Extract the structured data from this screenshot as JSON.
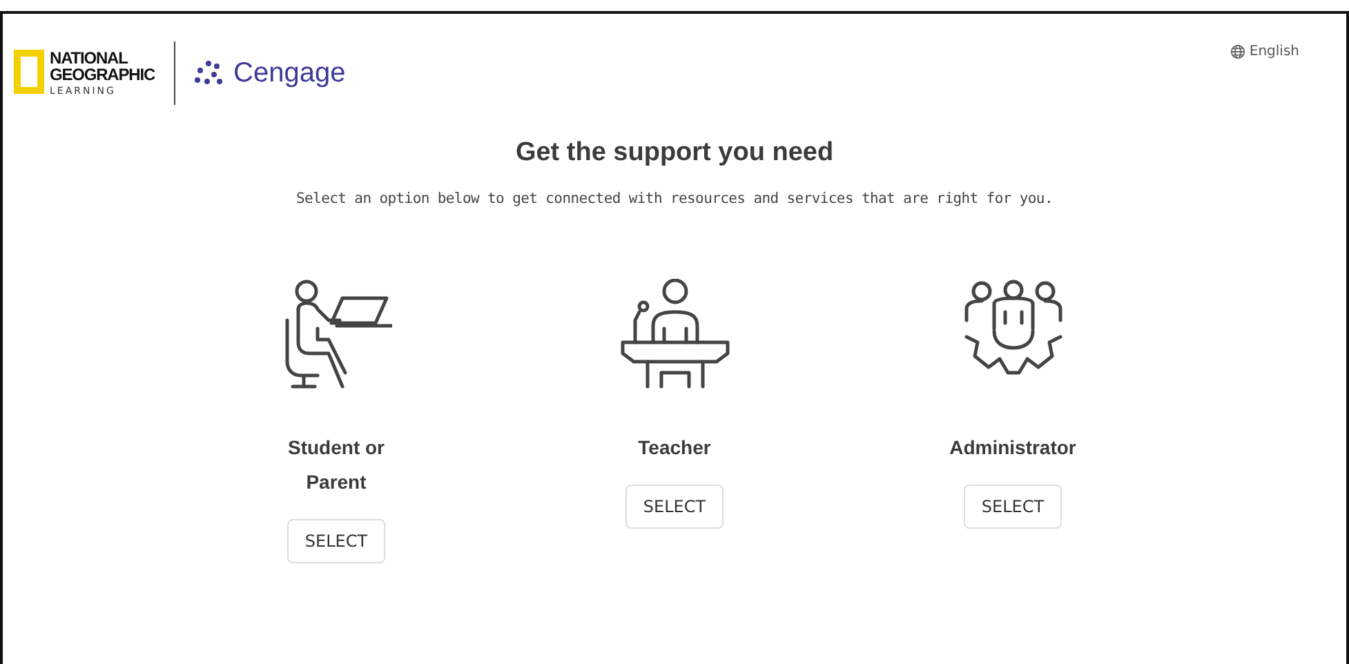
{
  "header": {
    "logo_lines": [
      "NATIONAL",
      "GEOGRAPHIC",
      "LEARNING"
    ],
    "brand": "Cengage",
    "language": "English"
  },
  "heading": "Get the support you need",
  "subheading": "Select an option below to get connected with resources and services that are right for you.",
  "options": [
    {
      "kind": "student",
      "label": "Student or Parent",
      "button": "SELECT"
    },
    {
      "kind": "teacher",
      "label": "Teacher",
      "button": "SELECT"
    },
    {
      "kind": "admin",
      "label": "Administrator",
      "button": "SELECT"
    }
  ]
}
